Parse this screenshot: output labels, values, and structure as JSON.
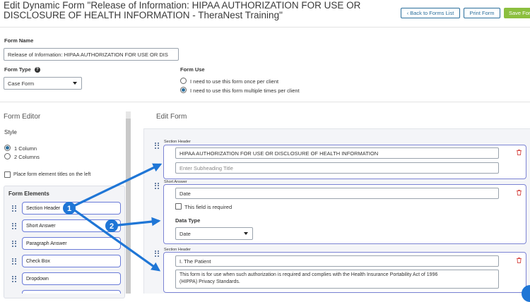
{
  "header": {
    "title": "Edit Dynamic Form \"Release of Information: HIPAA AUTHORIZATION FOR USE OR DISCLOSURE OF HEALTH INFORMATION - TheraNest Training\"",
    "back_label": "Back to Forms List",
    "print_label": "Print Form",
    "save_label": "Save Form"
  },
  "form": {
    "name_label": "Form Name",
    "name_value": "Release of Information: HIPAA AUTHORIZATION FOR USE OR DIS",
    "type_label": "Form Type",
    "type_value": "Case Form",
    "use_label": "Form Use",
    "use_options": [
      "I need to use this form once per client",
      "I need to use this form multiple times per client"
    ],
    "use_selected": 1
  },
  "editor": {
    "title": "Form Editor",
    "style_label": "Style",
    "style_options": [
      "1 Column",
      "2 Columns"
    ],
    "style_selected": 0,
    "place_titles_label": "Place form element titles on the left",
    "elements_title": "Form Elements",
    "elements": [
      "Section Header",
      "Short Answer",
      "Paragraph Answer",
      "Check Box",
      "Dropdown"
    ]
  },
  "edit_form": {
    "title": "Edit Form",
    "cards": [
      {
        "type_label": "Section Header",
        "value": "HIPAA AUTHORIZATION FOR USE OR DISCLOSURE OF HEALTH INFORMATION",
        "subheading_placeholder": "Enter Subheading Title"
      },
      {
        "type_label": "Short Answer",
        "value": "Date",
        "required_label": "This field is required",
        "data_type_label": "Data Type",
        "data_type_value": "Date"
      },
      {
        "type_label": "Section Header",
        "value": "I. The Patient",
        "subheading_line1": "This form is for use when such authorization is required and complies with the Health Insurance Portability Act of 1996",
        "subheading_line2": "(HIPPA) Privacy Standards."
      }
    ]
  },
  "annotations": [
    "1",
    "2"
  ],
  "colors": {
    "accent": "#2a6e9c",
    "save": "#8cbf3f",
    "arrow": "#1f76d6",
    "card_border": "#7c84d4"
  }
}
